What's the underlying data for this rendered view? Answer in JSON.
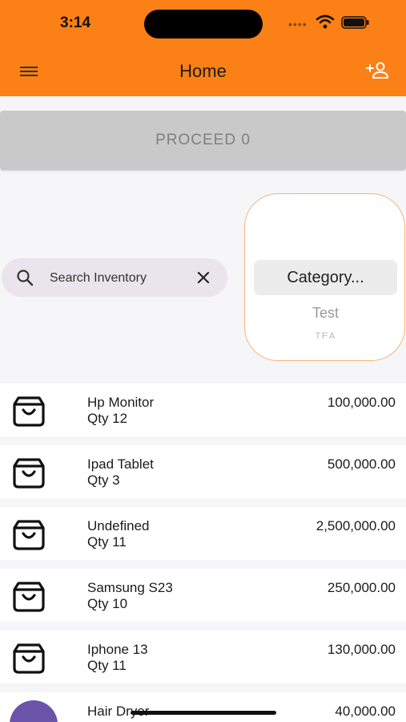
{
  "status_bar": {
    "time": "3:14",
    "signal_dots": "••••"
  },
  "header": {
    "title": "Home",
    "menu_icon": "hamburger-menu-icon",
    "add_icon": "add-user-icon"
  },
  "proceed": {
    "label": "PROCEED 0"
  },
  "search": {
    "placeholder": "Search Inventory",
    "value": ""
  },
  "category": {
    "selected": "Category...",
    "options": [
      "Test",
      "TEA"
    ]
  },
  "products": [
    {
      "name": "Hp Monitor",
      "qty": "Qty 12",
      "price": "100,000.00"
    },
    {
      "name": "Ipad Tablet",
      "qty": "Qty 3",
      "price": "500,000.00"
    },
    {
      "name": "Undefined",
      "qty": "Qty 11",
      "price": "2,500,000.00"
    },
    {
      "name": "Samsung S23",
      "qty": "Qty 10",
      "price": "250,000.00"
    },
    {
      "name": "Iphone 13",
      "qty": "Qty 11",
      "price": "130,000.00"
    },
    {
      "name": "Hair Dryer",
      "qty": "",
      "price": "40,000.00"
    }
  ],
  "colors": {
    "accent": "#fb8015",
    "proceed_bg": "#c9c9c9",
    "avatar": "#6a53a8"
  }
}
